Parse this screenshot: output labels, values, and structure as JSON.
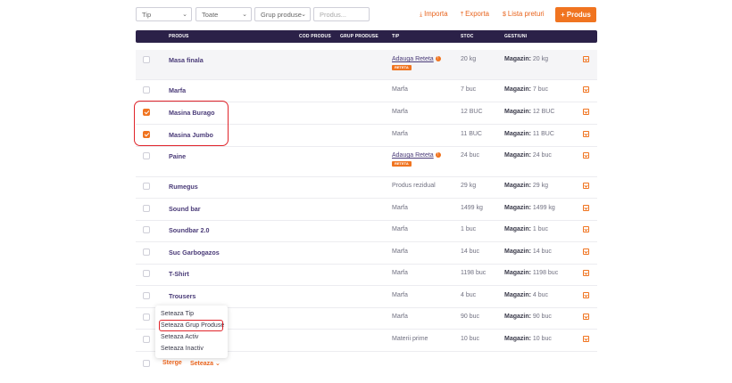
{
  "filters": {
    "type_select": "Tip",
    "all_select": "Toate",
    "group_select": "Grup produse",
    "search_placeholder": "Produs..."
  },
  "actions": {
    "import": "Importa",
    "export": "Exporta",
    "price_list": "Lista preturi",
    "add_product": "+ Produs"
  },
  "table_headers": {
    "product": "PRODUS",
    "code": "COD PRODUS",
    "group": "GRUP PRODUSE",
    "type": "TIP",
    "stock": "STOC",
    "management": "GESTIUNI"
  },
  "rows": [
    {
      "name": "Masa finala",
      "type_link": "Adauga Reteta",
      "badge": "RETETA",
      "stock": "20 kg",
      "loc": "Magazin:",
      "loc_val": "20 kg",
      "checked": false
    },
    {
      "name": "Marfa",
      "type": "Marfa",
      "stock": "7 buc",
      "loc": "Magazin:",
      "loc_val": "7 buc",
      "checked": false
    },
    {
      "name": "Masina Burago",
      "type": "Marfa",
      "stock": "12 BUC",
      "loc": "Magazin:",
      "loc_val": "12 BUC",
      "checked": true
    },
    {
      "name": "Masina Jumbo",
      "type": "Marfa",
      "stock": "11 BUC",
      "loc": "Magazin:",
      "loc_val": "11 BUC",
      "checked": true
    },
    {
      "name": "Paine",
      "type_link": "Adauga Reteta",
      "badge": "RETETA",
      "stock": "24 buc",
      "loc": "Magazin:",
      "loc_val": "24 buc",
      "checked": false
    },
    {
      "name": "Rumegus",
      "type": "Produs rezidual",
      "stock": "29 kg",
      "loc": "Magazin:",
      "loc_val": "29 kg",
      "checked": false
    },
    {
      "name": "Sound bar",
      "type": "Marfa",
      "stock": "1499 kg",
      "loc": "Magazin:",
      "loc_val": "1499 kg",
      "checked": false
    },
    {
      "name": "Soundbar 2.0",
      "type": "Marfa",
      "stock": "1 buc",
      "loc": "Magazin:",
      "loc_val": "1 buc",
      "checked": false
    },
    {
      "name": "Suc Garbogazos",
      "type": "Marfa",
      "stock": "14 buc",
      "loc": "Magazin:",
      "loc_val": "14 buc",
      "checked": false
    },
    {
      "name": "T-Shirt",
      "type": "Marfa",
      "stock": "1198 buc",
      "loc": "Magazin:",
      "loc_val": "1198 buc",
      "checked": false
    },
    {
      "name": "Trousers",
      "type": "Marfa",
      "stock": "4 buc",
      "loc": "Magazin:",
      "loc_val": "4 buc",
      "checked": false
    },
    {
      "name": "",
      "type": "Marfa",
      "stock": "90 buc",
      "loc": "Magazin:",
      "loc_val": "90 buc",
      "checked": false
    },
    {
      "name": "",
      "type": "Materii prime",
      "stock": "10 buc",
      "loc": "Magazin:",
      "loc_val": "10 buc",
      "checked": false
    }
  ],
  "context_menu": {
    "items": [
      "Seteaza Tip",
      "Seteaza Grup Produse",
      "Seteaza Activ",
      "Seteaza Inactiv"
    ]
  },
  "bulk": {
    "delete": "Sterge",
    "set": "Seteaza"
  },
  "colors": {
    "accent": "#f07420",
    "header_bg": "#2b2148",
    "highlight": "#e0242a"
  }
}
